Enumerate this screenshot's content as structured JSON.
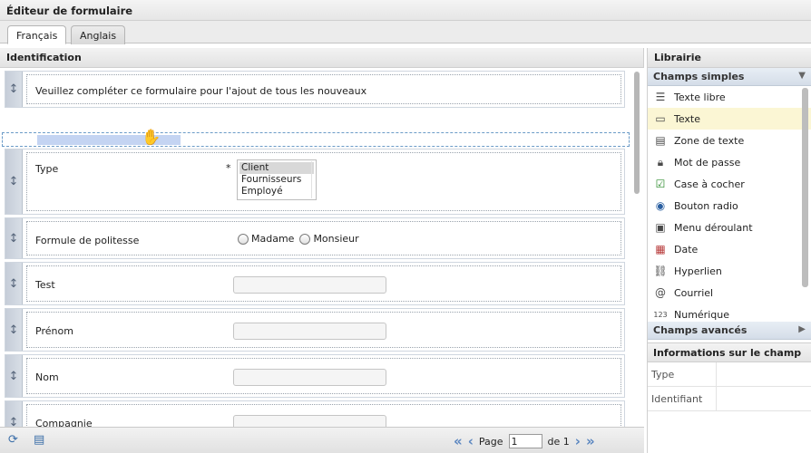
{
  "window": {
    "title": "Éditeur de formulaire"
  },
  "tabs": [
    {
      "label": "Français",
      "active": true
    },
    {
      "label": "Anglais",
      "active": false
    }
  ],
  "form_panel": {
    "header": "Identification",
    "rows": [
      {
        "label": "Veuillez compléter ce formulaire pour l'ajout de tous les nouveaux"
      },
      {
        "label": "Type",
        "required": "*",
        "options": [
          "Client",
          "Fournisseurs",
          "Employé"
        ],
        "selected": "Client"
      },
      {
        "label": "Formule de politesse",
        "radios": [
          "Madame",
          "Monsieur"
        ]
      },
      {
        "label": "Test",
        "value": ""
      },
      {
        "label": "Prénom",
        "value": ""
      },
      {
        "label": "Nom",
        "value": ""
      },
      {
        "label": "Compagnie",
        "value": ""
      }
    ]
  },
  "pager": {
    "page_label": "Page",
    "page_value": "1",
    "of_label": "de 1"
  },
  "library": {
    "header": "Librairie",
    "simple_section": "Champs simples",
    "items": [
      {
        "label": "Texte libre",
        "icon": "lines-icon"
      },
      {
        "label": "Texte",
        "icon": "textbox-icon",
        "highlighted": true
      },
      {
        "label": "Zone de texte",
        "icon": "textarea-icon"
      },
      {
        "label": "Mot de passe",
        "icon": "lock-icon"
      },
      {
        "label": "Case à cocher",
        "icon": "checkbox-icon"
      },
      {
        "label": "Bouton radio",
        "icon": "radio-icon"
      },
      {
        "label": "Menu déroulant",
        "icon": "dropdown-icon"
      },
      {
        "label": "Date",
        "icon": "calendar-icon"
      },
      {
        "label": "Hyperlien",
        "icon": "link-icon"
      },
      {
        "label": "Courriel",
        "icon": "at-icon"
      },
      {
        "label": "Numérique",
        "icon": "numeric-icon"
      }
    ],
    "advanced_section": "Champs avancés"
  },
  "field_info": {
    "header": "Informations sur le champ",
    "rows": [
      {
        "key": "Type",
        "value": ""
      },
      {
        "key": "Identifiant",
        "value": ""
      }
    ]
  },
  "colors": {
    "highlight": "#fbf6d4",
    "drop_zone": "#c4d4f2",
    "accent": "#5a86c0"
  }
}
